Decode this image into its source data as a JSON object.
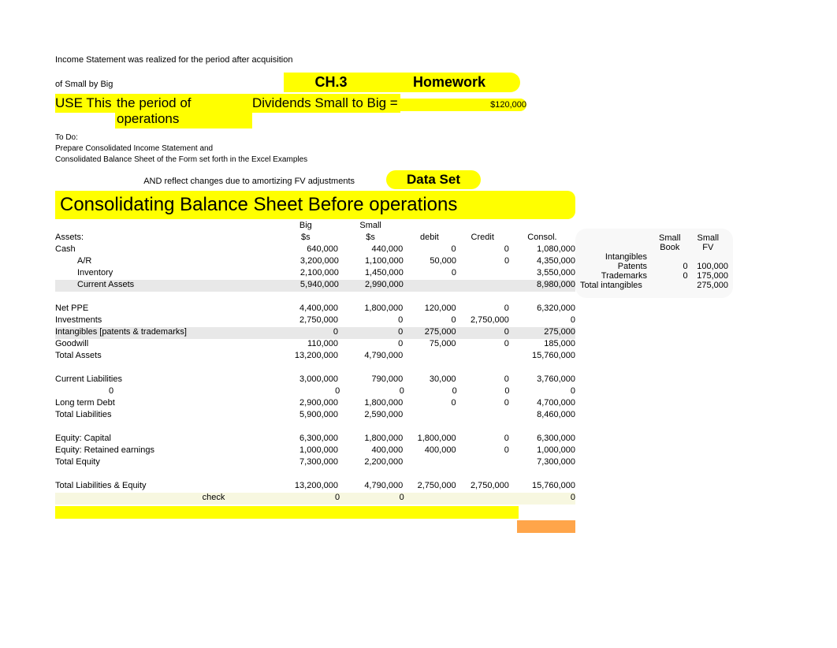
{
  "header": {
    "line1": "Income Statement was realized for the period after acquisition",
    "line2": "of Small by Big",
    "ch3": "CH.3",
    "homework": "Homework",
    "use_this": "USE This",
    "period": "the period of operations",
    "div_label": "Dividends Small to Big =",
    "div_amt": "$120,000",
    "todo1": "To Do:",
    "todo2": "Prepare Consolidated Income Statement and",
    "todo3": "Consolidated Balance Sheet of the Form set forth in the Excel Examples",
    "and_text": "AND reflect changes due to amortizing FV adjustments",
    "dataset": "Data Set",
    "consol_title": "Consolidating Balance Sheet Before operations"
  },
  "cols": {
    "big": "Big",
    "small": "Small",
    "bigs": "$s",
    "smalls": "$s",
    "debit": "debit",
    "credit": "Credit",
    "consol": "Consol."
  },
  "rows": {
    "assets": "Assets:",
    "cash": {
      "label": "Cash",
      "big": "640,000",
      "small": "440,000",
      "debit": "0",
      "credit": "0",
      "consol": "1,080,000"
    },
    "ar": {
      "label": "A/R",
      "big": "3,200,000",
      "small": "1,100,000",
      "debit": "50,000",
      "credit": "0",
      "consol": "4,350,000"
    },
    "inv": {
      "label": "Inventory",
      "big": "2,100,000",
      "small": "1,450,000",
      "debit": "0",
      "credit": "",
      "consol": "3,550,000"
    },
    "ca": {
      "label": "Current Assets",
      "big": "5,940,000",
      "small": "2,990,000",
      "debit": "",
      "credit": "",
      "consol": "8,980,000"
    },
    "netppe": {
      "label": "Net PPE",
      "big": "4,400,000",
      "small": "1,800,000",
      "debit": "120,000",
      "credit": "0",
      "consol": "6,320,000"
    },
    "invst": {
      "label": "Investments",
      "big": "2,750,000",
      "small": "0",
      "debit": "0",
      "credit": "2,750,000",
      "consol": "0"
    },
    "intan": {
      "label": "Intangibles [patents & trademarks]",
      "big": "0",
      "small": "0",
      "debit": "275,000",
      "credit": "0",
      "consol": "275,000"
    },
    "gw": {
      "label": "Goodwill",
      "big": "110,000",
      "small": "0",
      "debit": "75,000",
      "credit": "0",
      "consol": "185,000"
    },
    "ta": {
      "label": "Total Assets",
      "big": "13,200,000",
      "small": "4,790,000",
      "debit": "",
      "credit": "",
      "consol": "15,760,000"
    },
    "cl": {
      "label": "Current Liabilities",
      "big": "3,000,000",
      "small": "790,000",
      "debit": "30,000",
      "credit": "0",
      "consol": "3,760,000"
    },
    "zero": {
      "label": "0",
      "big": "0",
      "small": "0",
      "debit": "0",
      "credit": "0",
      "consol": "0"
    },
    "ltd": {
      "label": "Long term Debt",
      "big": "2,900,000",
      "small": "1,800,000",
      "debit": "0",
      "credit": "0",
      "consol": "4,700,000"
    },
    "tl": {
      "label": "Total Liabilities",
      "big": "5,900,000",
      "small": "2,590,000",
      "debit": "",
      "credit": "",
      "consol": "8,460,000"
    },
    "eqcap": {
      "label": "Equity: Capital",
      "big": "6,300,000",
      "small": "1,800,000",
      "debit": "1,800,000",
      "credit": "0",
      "consol": "6,300,000"
    },
    "eqre": {
      "label": "Equity: Retained earnings",
      "big": "1,000,000",
      "small": "400,000",
      "debit": "400,000",
      "credit": "0",
      "consol": "1,000,000"
    },
    "te": {
      "label": "Total Equity",
      "big": "7,300,000",
      "small": "2,200,000",
      "debit": "",
      "credit": "",
      "consol": "7,300,000"
    },
    "tle": {
      "label": "Total Liabilities & Equity",
      "big": "13,200,000",
      "small": "4,790,000",
      "debit": "2,750,000",
      "credit": "2,750,000",
      "consol": "15,760,000"
    },
    "check": {
      "label": "check",
      "big": "0",
      "small": "0",
      "debit": "",
      "credit": "",
      "consol": "0"
    }
  },
  "side": {
    "h1": "Small",
    "h2": "Small",
    "book": "Book",
    "fv": "FV",
    "intangibles": "Intangibles",
    "patents": {
      "label": "Patents",
      "book": "0",
      "fv": "100,000"
    },
    "trademarks": {
      "label": "Trademarks",
      "book": "0",
      "fv": "175,000"
    },
    "total": {
      "label": "Total intangibles",
      "book": "",
      "fv": "275,000"
    }
  }
}
